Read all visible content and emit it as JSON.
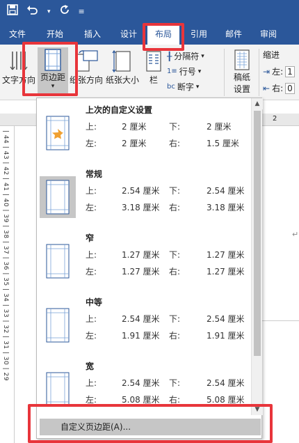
{
  "qat": {
    "save_icon": "save-icon",
    "undo_icon": "undo-icon",
    "redo_icon": "redo-icon",
    "customize_icon": "customize-icon"
  },
  "tabs": [
    "文件",
    "开始",
    "插入",
    "设计",
    "布局",
    "引用",
    "邮件",
    "审阅"
  ],
  "active_tab": "布局",
  "ribbon": {
    "text_direction": "文字方向",
    "margins": "页边距",
    "orientation": "纸张方向",
    "size": "纸张大小",
    "columns": "栏",
    "breaks": "分隔符",
    "line_numbers": "行号",
    "hyphenation": "断字",
    "draft_paper_1": "稿纸",
    "draft_paper_2": "设置",
    "indent": "缩进",
    "indent_left": "左:",
    "indent_right": "右:",
    "indent_left_value": "1",
    "indent_right_value": "0"
  },
  "ruler": {
    "top_number": "2",
    "left_numbers": "| 44 | 43 | 42 | 41 | 40 | 39 | 38 | 37 | 36 | 35 | 34 | 33 | 32 | 31 | 30 | 29"
  },
  "margins_menu": {
    "options": [
      {
        "name": "上次的自定义设置",
        "top_label": "上:",
        "top": "2 厘米",
        "bottom_label": "下:",
        "bottom": "2 厘米",
        "left_label": "左:",
        "left": "2 厘米",
        "right_label": "右:",
        "right": "1.5 厘米",
        "icon": "star-page-icon",
        "selected": false
      },
      {
        "name": "常规",
        "top_label": "上:",
        "top": "2.54 厘米",
        "bottom_label": "下:",
        "bottom": "2.54 厘米",
        "left_label": "左:",
        "left": "3.18 厘米",
        "right_label": "右:",
        "right": "3.18 厘米",
        "icon": "page-icon",
        "selected": true
      },
      {
        "name": "窄",
        "top_label": "上:",
        "top": "1.27 厘米",
        "bottom_label": "下:",
        "bottom": "1.27 厘米",
        "left_label": "左:",
        "left": "1.27 厘米",
        "right_label": "右:",
        "right": "1.27 厘米",
        "icon": "page-icon",
        "selected": false
      },
      {
        "name": "中等",
        "top_label": "上:",
        "top": "2.54 厘米",
        "bottom_label": "下:",
        "bottom": "2.54 厘米",
        "left_label": "左:",
        "left": "1.91 厘米",
        "right_label": "右:",
        "right": "1.91 厘米",
        "icon": "page-icon",
        "selected": false
      },
      {
        "name": "宽",
        "top_label": "上:",
        "top": "2.54 厘米",
        "bottom_label": "下:",
        "bottom": "2.54 厘米",
        "left_label": "左:",
        "left": "5.08 厘米",
        "right_label": "右:",
        "right": "5.08 厘米",
        "icon": "page-icon",
        "selected": false
      }
    ],
    "custom_label": "自定义页边距(A)..."
  },
  "colors": {
    "accent": "#2b579a",
    "highlight": "#e8353b",
    "selected_bg": "#c6c6c6",
    "star": "#f0a030"
  }
}
